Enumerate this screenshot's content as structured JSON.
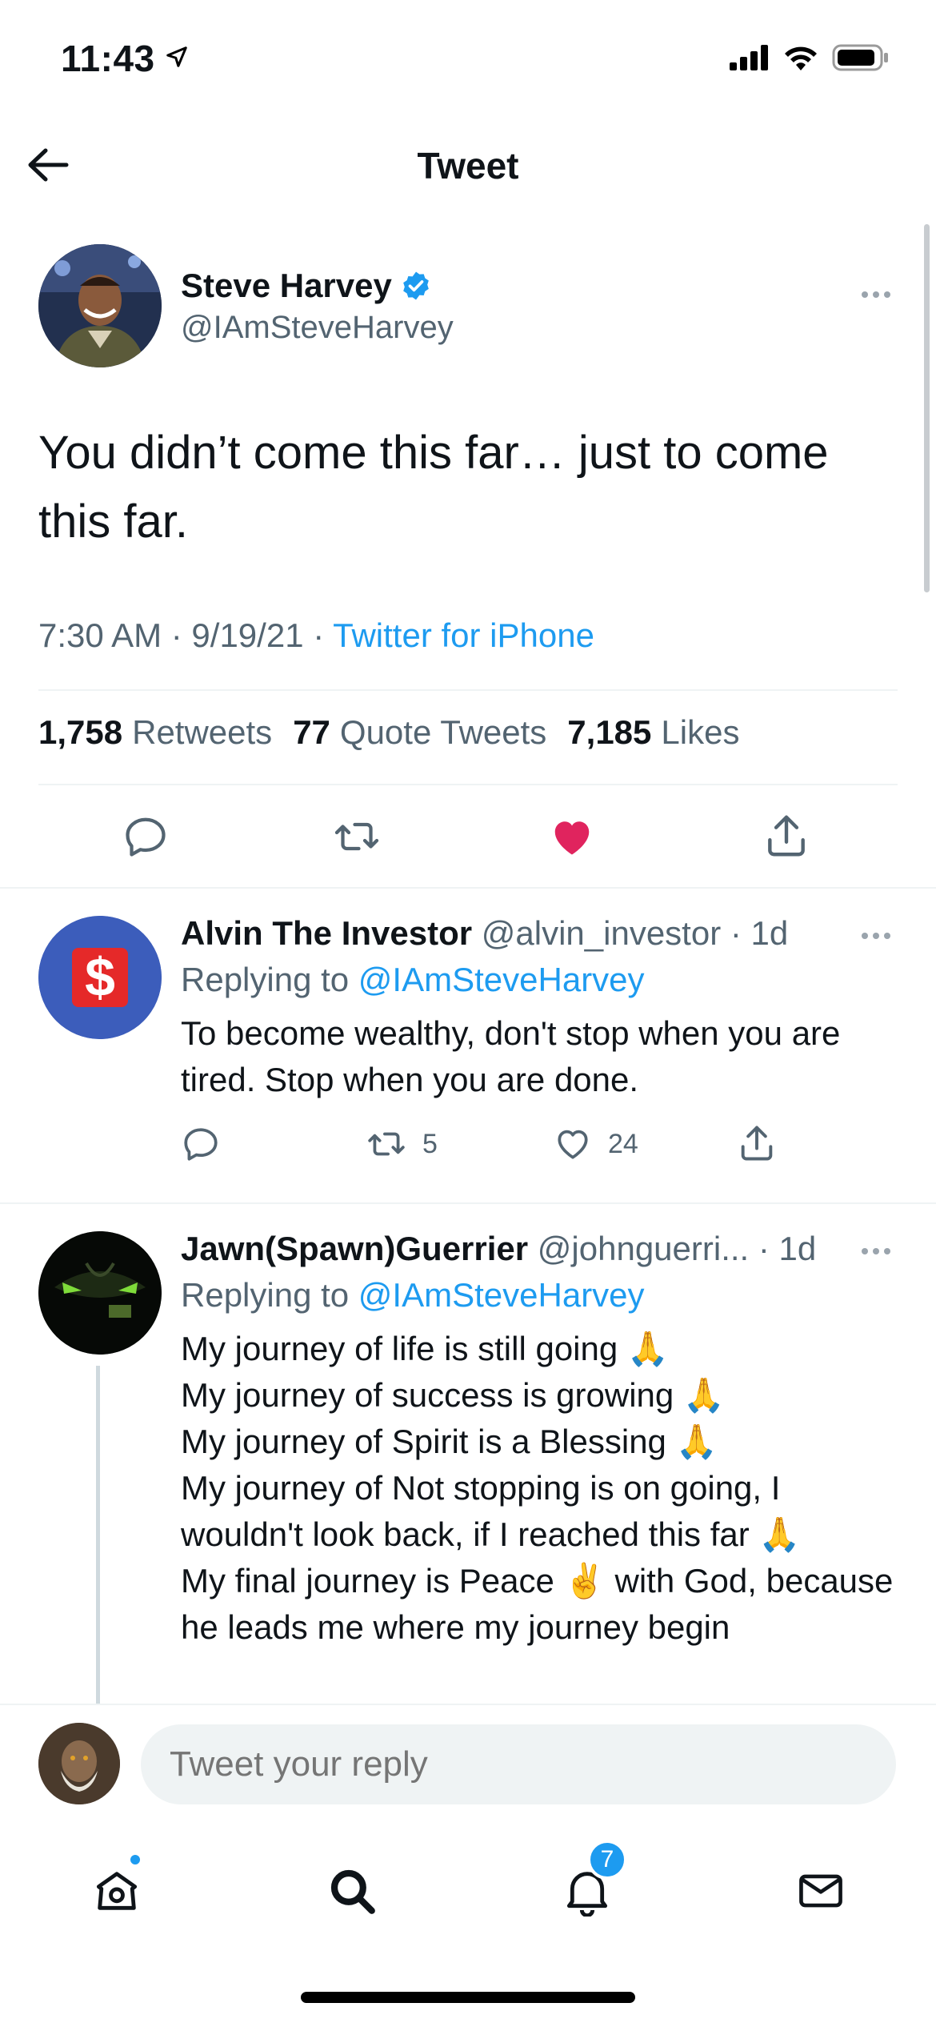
{
  "status_bar": {
    "time": "11:43"
  },
  "header": {
    "title": "Tweet"
  },
  "main_tweet": {
    "author_name": "Steve Harvey",
    "author_handle": "@IAmSteveHarvey",
    "text": "You didn’t come this far… just to come this far.",
    "time": "7:30 AM · 9/19/21 · ",
    "source": "Twitter for iPhone",
    "stats": {
      "retweets_count": "1,758",
      "retweets_label": "Retweets",
      "quotes_count": "77",
      "quotes_label": "Quote Tweets",
      "likes_count": "7,185",
      "likes_label": "Likes"
    },
    "liked": true,
    "colors": {
      "like": "#f91880",
      "verified": "#1d9bf0"
    }
  },
  "replies": [
    {
      "name": "Alvin The Investor",
      "handle": "@alvin_investor",
      "age": " · 1d",
      "replying_prefix": "Replying to ",
      "replying_to": "@IAmSteveHarvey",
      "text": "To become wealthy, don't stop when you are tired. Stop when you are done.",
      "retweets": "5",
      "likes": "24"
    },
    {
      "name": "Jawn(Spawn)Guerrier",
      "handle": "@johnguerri...",
      "age": " · 1d",
      "replying_prefix": "Replying to ",
      "replying_to": "@IAmSteveHarvey",
      "text": "My journey of life is still going 🙏\nMy journey of success is growing  🙏\nMy journey of Spirit is a Blessing 🙏\nMy journey of Not stopping is on going, I wouldn't look back, if I reached this far 🙏\nMy final journey is Peace ✌️ with God, because he leads me where my journey begin"
    }
  ],
  "reply_bar": {
    "placeholder": "Tweet your reply"
  },
  "tab_bar": {
    "notifications_count": "7"
  }
}
